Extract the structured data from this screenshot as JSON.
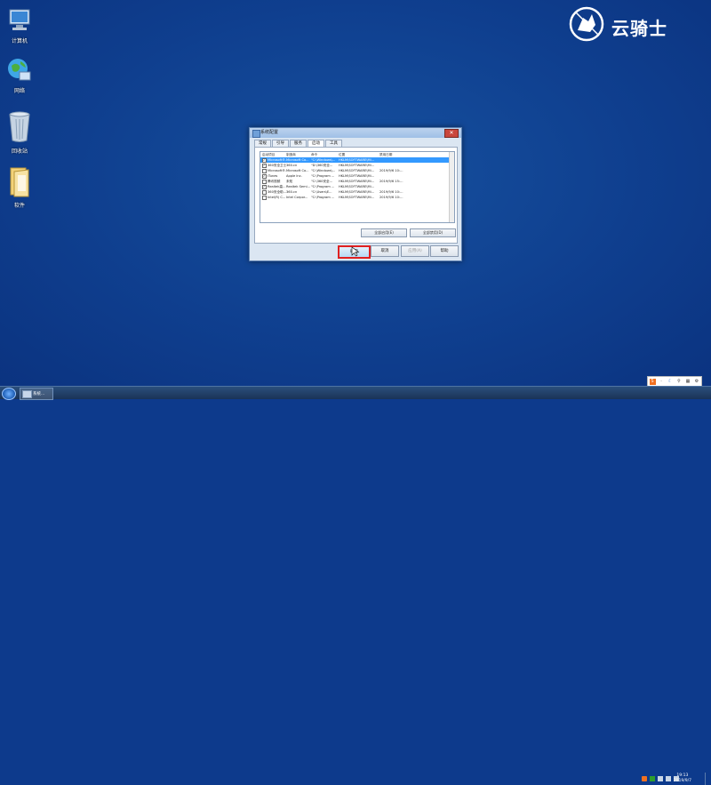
{
  "desktop": {
    "icons": [
      {
        "label": "计算机"
      },
      {
        "label": "网络"
      },
      {
        "label": "回收站"
      },
      {
        "label": "软件"
      }
    ]
  },
  "logo": {
    "text": "云骑士"
  },
  "dialog": {
    "title": "系统配置",
    "tabs": [
      "常规",
      "引导",
      "服务",
      "启动",
      "工具"
    ],
    "active_tab": "启动",
    "columns": [
      "启动项目",
      "制造商",
      "命令",
      "位置",
      "禁用日期"
    ],
    "rows": [
      {
        "checked": true,
        "item": "Microsoft®...",
        "maker": "Microsoft Co...",
        "cmd": "\"C:\\Windows\\...",
        "loc": "HKLM\\SOFTWARE\\Mi...",
        "date": "",
        "selected": true
      },
      {
        "checked": true,
        "item": "360安全卫士",
        "maker": "360.cn",
        "cmd": "\"D:\\360安全...",
        "loc": "HKLM\\SOFTWARE\\Mi...",
        "date": "",
        "selected": false
      },
      {
        "checked": false,
        "item": "Microsoft®...",
        "maker": "Microsoft Co...",
        "cmd": "\"C:\\Windows\\...",
        "loc": "HKLM\\SOFTWARE\\Mi...",
        "date": "2019/9/6 10:...",
        "selected": false
      },
      {
        "checked": true,
        "item": "iTunes",
        "maker": "Apple Inc.",
        "cmd": "\"C:\\Program ...",
        "loc": "HKLM\\SOFTWARE\\Mi...",
        "date": "",
        "selected": false
      },
      {
        "checked": false,
        "item": "腾讯视频",
        "maker": "未知",
        "cmd": "\"C:\\360安全...",
        "loc": "HKLM\\SOFTWARE\\Mi...",
        "date": "2019/9/6 15:...",
        "selected": false
      },
      {
        "checked": true,
        "item": "Realtek高...",
        "maker": "Realtek Semi...",
        "cmd": "\"C:\\Program ...",
        "loc": "HKLM\\SOFTWARE\\Mi...",
        "date": "",
        "selected": false
      },
      {
        "checked": false,
        "item": "360安全助...",
        "maker": "360.cn",
        "cmd": "\"C:\\Users\\E...",
        "loc": "HKLM\\SOFTWARE\\Mi...",
        "date": "2019/9/6 10:...",
        "selected": false
      },
      {
        "checked": false,
        "item": "Intel(R) C...",
        "maker": "Intel Corpor...",
        "cmd": "\"C:\\Program ...",
        "loc": "HKLM\\SOFTWARE\\Mi...",
        "date": "2019/9/6 10:...",
        "selected": false
      }
    ],
    "enable_all": "全部启用(E)",
    "disable_all": "全部禁用(D)",
    "ok": "确定",
    "cancel": "取消",
    "apply": "应用(A)",
    "help": "帮助"
  },
  "taskbar": {
    "item_label": "系统...",
    "time": "19:13",
    "date": "2019/9/7"
  },
  "colors": {
    "desktop_bg": "#0f3f8f",
    "selected_row": "#3399ff",
    "highlight_border": "#e02020"
  }
}
